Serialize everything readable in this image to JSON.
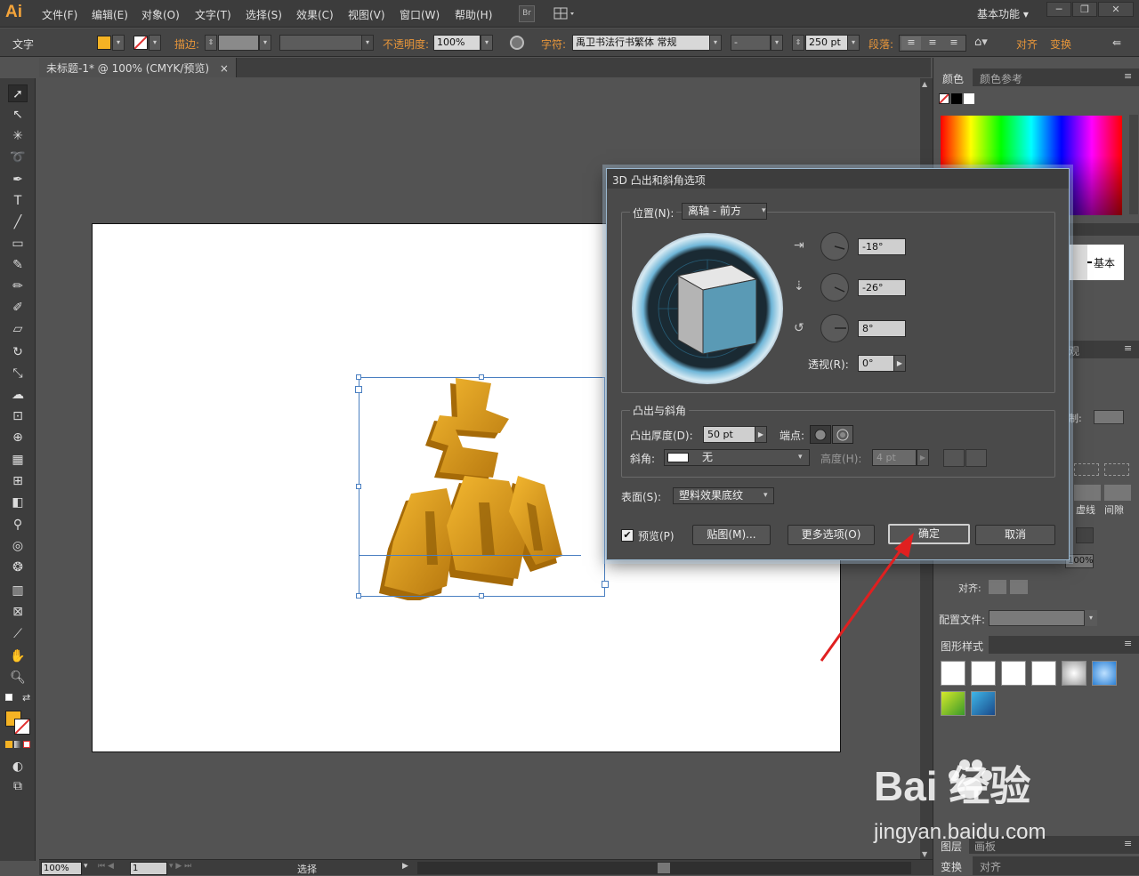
{
  "app": {
    "logo": "Ai"
  },
  "menu": [
    "文件(F)",
    "编辑(E)",
    "对象(O)",
    "文字(T)",
    "选择(S)",
    "效果(C)",
    "视图(V)",
    "窗口(W)",
    "帮助(H)"
  ],
  "menubar": {
    "bridge_label": "Br",
    "workspace": "基本功能",
    "workspace_arrow": "▾"
  },
  "control": {
    "tool_label": "文字",
    "stroke_label": "描边:",
    "opacity_label": "不透明度:",
    "opacity_value": "100%",
    "char_label": "字符:",
    "font_value": "禹卫书法行书繁体 常规",
    "font_style_value": "-",
    "font_size_value": "250 pt",
    "para_label": "段落:",
    "align_label": "对齐",
    "transform_label": "变换",
    "fill_color": "#f5b324"
  },
  "document_tab": {
    "title": "未标题-1* @ 100% (CMYK/预览)",
    "close": "×"
  },
  "status": {
    "zoom": "100%",
    "artboard": "1",
    "tool": "选择"
  },
  "panels": {
    "color_tab": "颜色",
    "color_guide_tab": "颜色参考",
    "stroke_basic": "基本",
    "appearance_tab": "观",
    "gap": "虚线",
    "spacing": "间隙",
    "limit": "制:",
    "scale_value": "100%",
    "align_label": "对齐:",
    "profile_label": "配置文件:",
    "graphic_styles_tab": "图形样式",
    "layers_tab": "图层",
    "artboards_tab": "画板",
    "transform_tab": "变换",
    "align_tab": "对齐"
  },
  "dialog": {
    "title": "3D 凸出和斜角选项",
    "position_label": "位置(N):",
    "position_value": "离轴 - 前方",
    "rot_x": "-18°",
    "rot_y": "-26°",
    "rot_z": "8°",
    "perspective_label": "透视(R):",
    "perspective_value": "0°",
    "extrude_section": "凸出与斜角",
    "depth_label": "凸出厚度(D):",
    "depth_value": "50 pt",
    "cap_label": "端点:",
    "bevel_label": "斜角:",
    "bevel_value": "无",
    "height_label": "高度(H):",
    "height_value": "4 pt",
    "surface_label": "表面(S):",
    "surface_value": "塑料效果底纹",
    "preview_label": "预览(P)",
    "map_button": "贴图(M)...",
    "more_button": "更多选项(O)",
    "ok_button": "确定",
    "cancel_button": "取消",
    "cube_color": "#5a9ab5"
  },
  "artwork": {
    "glyph": "飘",
    "color": "#e0a020"
  },
  "watermark": {
    "brand": "Bai  经验",
    "url": "jingyan.baidu.com"
  }
}
